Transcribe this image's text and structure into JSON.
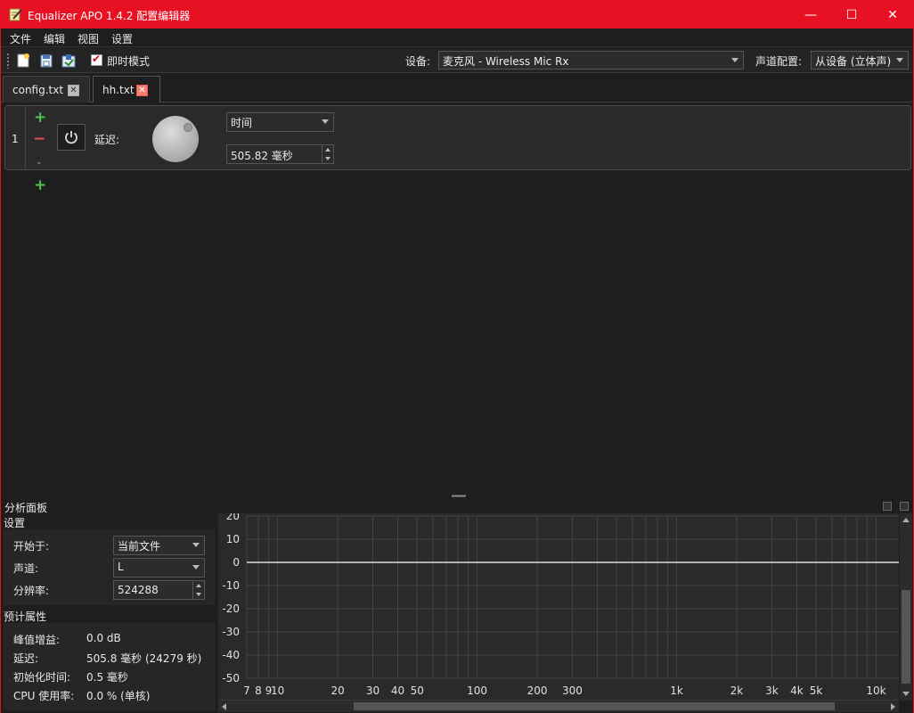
{
  "window": {
    "title": "Equalizer APO 1.4.2 配置编辑器",
    "controls": {
      "minimize": "—",
      "maximize": "☐",
      "close": "✕"
    },
    "accent": "#e81123"
  },
  "menu": [
    "文件",
    "编辑",
    "视图",
    "设置"
  ],
  "toolbar": {
    "instant_mode_label": "即时模式",
    "instant_mode_checked": true,
    "device_label": "设备:",
    "device_value": "麦克风 - Wireless Mic Rx",
    "channel_config_label": "声道配置:",
    "channel_config_value": "从设备 (立体声)"
  },
  "tabs": [
    {
      "label": "config.txt",
      "active": false
    },
    {
      "label": "hh.txt",
      "active": true
    }
  ],
  "filter": {
    "index": "1",
    "delay_label": "延迟:",
    "unit_select": "时间",
    "value": "505.82 毫秒"
  },
  "analysis": {
    "panel_title": "分析面板",
    "settings_title": "设置",
    "start_label": "开始于:",
    "start_value": "当前文件",
    "channel_label": "声道:",
    "channel_value": "L",
    "resolution_label": "分辨率:",
    "resolution_value": "524288",
    "props_title": "预计属性",
    "peak_label": "峰值增益:",
    "peak_value": "0.0 dB",
    "latency_label": "延迟:",
    "latency_value": "505.8 毫秒 (24279 秒)",
    "init_label": "初始化时间:",
    "init_value": "0.5 毫秒",
    "cpu_label": "CPU 使用率:",
    "cpu_value": "0.0 % (单核)"
  },
  "chart_data": {
    "type": "line",
    "x_scale": "log",
    "xlim": [
      7,
      13000
    ],
    "ylim": [
      -50,
      20
    ],
    "y_ticks": [
      20,
      10,
      0,
      -10,
      -20,
      -30,
      -40,
      -50
    ],
    "x_ticks": [
      {
        "v": 7,
        "label": "7"
      },
      {
        "v": 8,
        "label": "8"
      },
      {
        "v": 9,
        "label": "9"
      },
      {
        "v": 10,
        "label": "10"
      },
      {
        "v": 20,
        "label": "20"
      },
      {
        "v": 30,
        "label": "30"
      },
      {
        "v": 40,
        "label": "40"
      },
      {
        "v": 50,
        "label": "50"
      },
      {
        "v": 100,
        "label": "100"
      },
      {
        "v": 200,
        "label": "200"
      },
      {
        "v": 300,
        "label": "300"
      },
      {
        "v": 1000,
        "label": "1k"
      },
      {
        "v": 2000,
        "label": "2k"
      },
      {
        "v": 3000,
        "label": "3k"
      },
      {
        "v": 4000,
        "label": "4k"
      },
      {
        "v": 5000,
        "label": "5k"
      },
      {
        "v": 10000,
        "label": "10k"
      }
    ],
    "grid": true,
    "series": [
      {
        "x": [
          7,
          13000
        ],
        "y": [
          0,
          0
        ],
        "color": "#ffffff"
      }
    ]
  }
}
